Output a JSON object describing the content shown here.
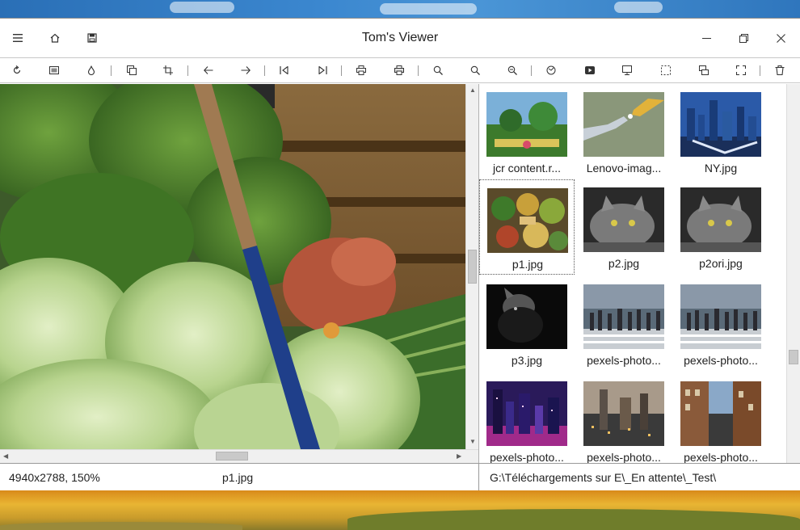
{
  "window": {
    "title": "Tom's Viewer"
  },
  "titlebar_icons": {
    "menu": "hamburger-icon",
    "home": "home-icon",
    "save": "save-icon"
  },
  "window_controls": [
    "minimize-icon",
    "maximize-icon",
    "close-icon"
  ],
  "toolbar": {
    "tools": [
      "rotate-icon",
      "fit-icon",
      "color-drop-icon",
      "copy-icon",
      "crop-icon",
      "prev-icon",
      "next-icon",
      "first-icon",
      "last-icon",
      "print-icon",
      "print-preview-icon",
      "zoom-in-icon",
      "zoom-icon",
      "zoom-out-icon",
      "web-icon",
      "slideshow-icon",
      "fullscreen-icon",
      "select-icon",
      "thumbnail-icon",
      "expand-icon",
      "delete-icon"
    ]
  },
  "thumbnails": [
    {
      "label": "jcr content.r...",
      "theme": "garden"
    },
    {
      "label": "Lenovo-imag...",
      "theme": "hands"
    },
    {
      "label": "NY.jpg",
      "theme": "skyline-night"
    },
    {
      "label": "p1.jpg",
      "theme": "market",
      "selected": true
    },
    {
      "label": "p2.jpg",
      "theme": "cat"
    },
    {
      "label": "p2ori.jpg",
      "theme": "cat"
    },
    {
      "label": "p3.jpg",
      "theme": "dark-cat"
    },
    {
      "label": "pexels-photo...",
      "theme": "crowd"
    },
    {
      "label": "pexels-photo...",
      "theme": "crowd"
    },
    {
      "label": "pexels-photo...",
      "theme": "city-purple"
    },
    {
      "label": "pexels-photo...",
      "theme": "city-dusk"
    },
    {
      "label": "pexels-photo...",
      "theme": "street"
    }
  ],
  "status": {
    "dimensions_zoom": "4940x2788, 150%",
    "filename": "p1.jpg",
    "path": "G:\\Téléchargements sur E\\_En attente\\_Test\\"
  },
  "colors": {
    "accent": "#2f74b8",
    "border": "#9a9a9a",
    "scrollbar": "#c9c9c9"
  }
}
